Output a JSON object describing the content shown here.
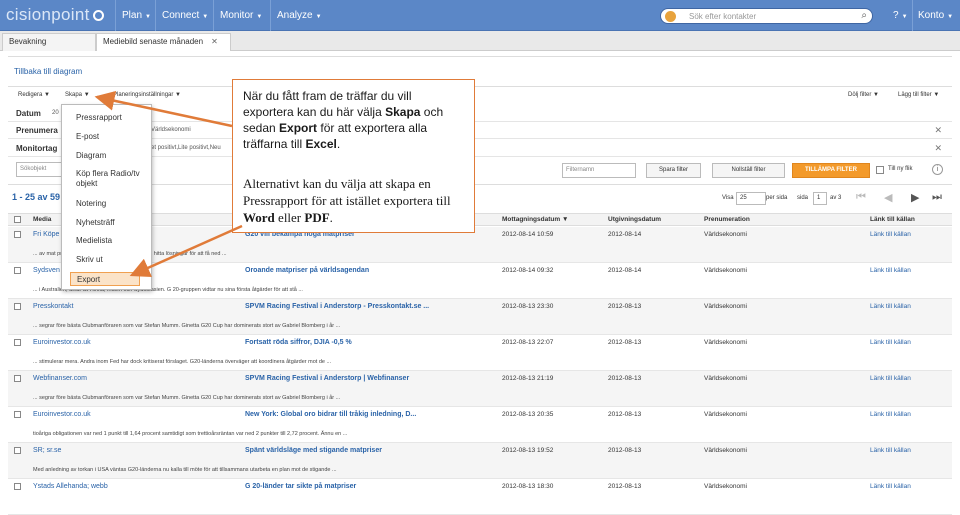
{
  "app": {
    "logo": "cisionpoint"
  },
  "nav": {
    "items": [
      {
        "label": "Plan"
      },
      {
        "label": "Connect"
      },
      {
        "label": "Monitor"
      },
      {
        "label": "Analyze"
      }
    ],
    "search_placeholder": "Sök efter kontakter",
    "help": "?",
    "account": "Konto"
  },
  "tabs": [
    {
      "label": "Bevakning"
    },
    {
      "label": "Mediebild senaste månaden"
    }
  ],
  "back_link": "Tillbaka till diagram",
  "toolbar": {
    "redigera": "Redigera",
    "skapa": "Skapa",
    "installningar": "Planeringsinställningar",
    "dolj": "Dölj filter",
    "lagg": "Lägg till filter"
  },
  "filters": [
    {
      "label": "Datum",
      "value": "20"
    },
    {
      "label": "Prenumera",
      "value": "Världsekonomi"
    },
    {
      "label": "Monitortag",
      "value": "et positivt,Lite positivt,Neu"
    }
  ],
  "filter_row": {
    "sokobjekt": "Sökobjekt",
    "filternamn": "Filternamn",
    "spara": "Spara filter",
    "nollstall": "Nollställ filter",
    "tillampa": "TILLÄMPA FILTER",
    "tillnyflik": "Till ny flik"
  },
  "pager": {
    "range": "1 - 25 av 59",
    "visa": "Visa",
    "perpage": "25",
    "per_sida": "per sida",
    "sida": "sida",
    "page": "1",
    "av": "av 3"
  },
  "columns": {
    "media": "Media",
    "mottagning": "Mottagningsdatum",
    "utgivning": "Utgivningsdatum",
    "prenumeration": "Prenumeration",
    "lank": "Länk till källan"
  },
  "rows": [
    {
      "source": "Fri Köpe",
      "title": "G20 vill bekämpa höga matpriser",
      "date": "2012-08-14 10:59",
      "pub_date": "2012-08-14",
      "sub": "Världsekonomi",
      "link": "Länk till källan",
      "snippet": "... av mat priser ... vill G 20-länderna tillsammans hitta lösningar för att få ned ..."
    },
    {
      "source": "Sydsven",
      "title": "Oroande matpriser på världsagendan",
      "date": "2012-08-14 09:32",
      "pub_date": "2012-08-14",
      "sub": "Världsekonomi",
      "link": "Länk till källan",
      "snippet": "... i Australien, delar av Afrika, Indien och Sydostasien. G 20-gruppen vidtar nu sina första åtgärder för att stå ..."
    },
    {
      "source": "Presskontakt",
      "title": "SPVM Racing Festival i Anderstorp - Presskontakt.se ...",
      "date": "2012-08-13 23:30",
      "pub_date": "2012-08-13",
      "sub": "Världsekonomi",
      "link": "Länk till källan",
      "snippet": "... segrar före bästa Clubmanföraren som var Stefan Mumm. Ginetta G20 Cup har dominerats stort av Gabriel Blomberg i år ..."
    },
    {
      "source": "Euroinvestor.co.uk",
      "title": "Fortsatt röda siffror, DJIA -0,5 %",
      "date": "2012-08-13 22:07",
      "pub_date": "2012-08-13",
      "sub": "Världsekonomi",
      "link": "Länk till källan",
      "snippet": "... stimulerar mera. Andra inom Fed har dock kritiserat förslaget. G20-länderna överväger att koordinera åtgärder mot de ..."
    },
    {
      "source": "Webfinanser.com",
      "title": "SPVM Racing Festival i Anderstorp | Webfinanser",
      "date": "2012-08-13 21:19",
      "pub_date": "2012-08-13",
      "sub": "Världsekonomi",
      "link": "Länk till källan",
      "snippet": "... segrar före bästa Clubmanföraren som var Stefan Mumm. Ginetta G20 Cup har dominerats stort av Gabriel Blomberg i år ..."
    },
    {
      "source": "Euroinvestor.co.uk",
      "title": "New York: Global oro bidrar till tråkig inledning, D...",
      "date": "2012-08-13 20:35",
      "pub_date": "2012-08-13",
      "sub": "Världsekonomi",
      "link": "Länk till källan",
      "snippet": "tioåriga obligationen var ned 1 punkt till 1,64 procent samtidigt som trettioårsräntan var ned 2 punkter till 2,72 procent. Ännu en ..."
    },
    {
      "source": "SR; sr.se",
      "title": "Spänt världsläge med stigande matpriser",
      "date": "2012-08-13 19:52",
      "pub_date": "2012-08-13",
      "sub": "Världsekonomi",
      "link": "Länk till källan",
      "snippet": "Med anledning av torkan i USA väntas G20-länderna nu kalla till möte för att tillsammans utarbeta en plan mot de stigande ..."
    },
    {
      "source": "Ystads Allehanda; webb",
      "title": "G 20-länder tar sikte på matpriser",
      "date": "2012-08-13 18:30",
      "pub_date": "2012-08-13",
      "sub": "Världsekonomi",
      "link": "Länk till källan",
      "snippet": ""
    }
  ],
  "dropdown": [
    "Pressrapport",
    "E-post",
    "Diagram",
    "Köp flera Radio/tv objekt",
    "Notering",
    "Nyhetsträff",
    "Medielista",
    "Skriv ut",
    "Export"
  ],
  "callout": {
    "p1a": "När du fått fram de träffar du vill exportera kan du här välja ",
    "p1b": "Skapa",
    "p1c": " och sedan ",
    "p1d": "Export",
    "p1e": " för att exportera alla träffarna till ",
    "p1f": "Excel",
    "p2a": "Alternativt kan du välja att skapa en Pressrapport för att istället exportera till ",
    "p2b": "Word",
    "p2c": " eller ",
    "p2d": "PDF",
    "p1end": ".",
    "p2end": "."
  },
  "colors": {
    "topbar": "#5b87c7",
    "accent_orange": "#f39a2b",
    "callout_border": "#e07b39",
    "link": "#2a63a8"
  }
}
